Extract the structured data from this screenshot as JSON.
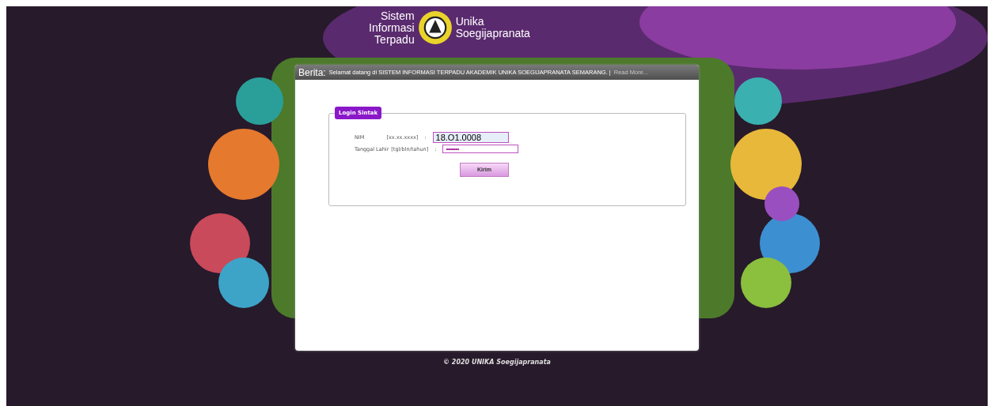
{
  "logo": {
    "left_lines": [
      "Sistem",
      "Informasi",
      "Terpadu"
    ],
    "right_lines": [
      "Unika",
      "Soegijapranata"
    ]
  },
  "news": {
    "label": "Berita:",
    "text": "Selamat datang di SISTEM INFORMASI TERPADU AKADEMIK UNIKA SOEGIJAPRANATA SEMARANG. |",
    "link": "Read More..."
  },
  "login": {
    "title": "Login Sintak",
    "fields": [
      {
        "label": "NIM",
        "hint": "[xx.xx.xxxx]",
        "colon": ":",
        "value": "18.O1.0008",
        "kind": "text"
      },
      {
        "label": "Tanggal Lahir",
        "hint": "[tgl/bln/tahun]",
        "colon": ":",
        "value": "•••••••••••",
        "kind": "password"
      }
    ],
    "button": "Kirim"
  },
  "footer": "© 2020 UNIKA Soegijapranata"
}
